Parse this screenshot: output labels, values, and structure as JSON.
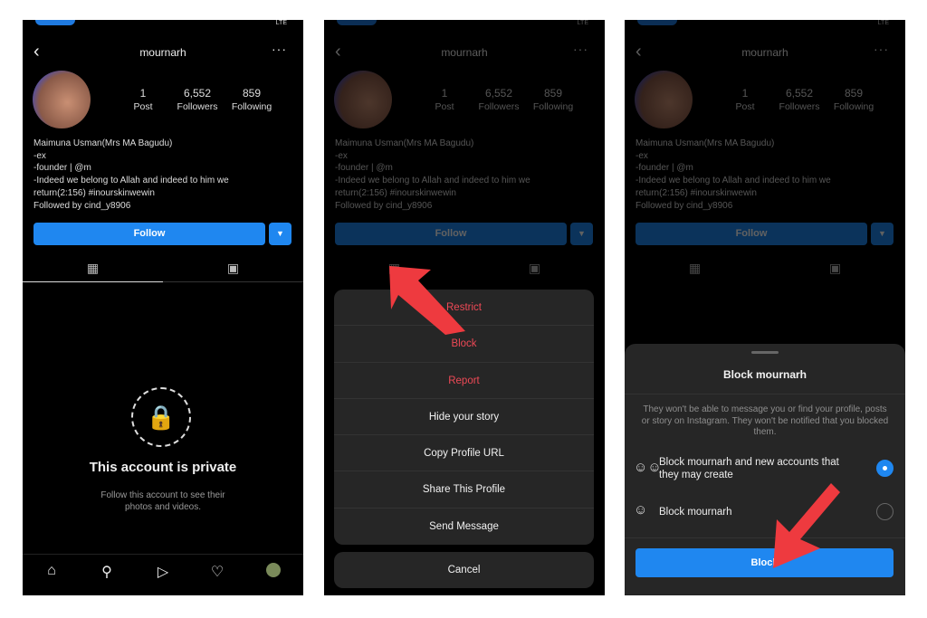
{
  "profile": {
    "username": "mournarh",
    "posts": "1",
    "posts_label": "Post",
    "followers": "6,552",
    "followers_label": "Followers",
    "following": "859",
    "following_label": "Following",
    "bio": [
      "Maimuna Usman(Mrs MA Bagudu)",
      "-ex",
      "-founder | @m",
      "-Indeed we belong to Allah and indeed to him we",
      "return(2:156) #inourskinwewin",
      "Followed by cind_y8906"
    ],
    "follow_label": "Follow",
    "private_title": "This account is private",
    "private_sub": "Follow this account to see their photos and videos.",
    "status_network": "LTE"
  },
  "action_sheet": {
    "items": [
      "Restrict",
      "Block",
      "Report",
      "Hide your story",
      "Copy Profile URL",
      "Share This Profile",
      "Send Message"
    ],
    "cancel": "Cancel"
  },
  "block_sheet": {
    "title": "Block mournarh",
    "description": "They won't be able to message you or find your profile, posts or story on Instagram. They won't be notified that you blocked them.",
    "option1": "Block mournarh and new accounts that they may create",
    "option2": "Block mournarh",
    "selected_option": 1,
    "button": "Block"
  },
  "colors": {
    "accent": "#1f87f0",
    "danger": "#ee4956",
    "arrow": "#ee3a3f"
  }
}
